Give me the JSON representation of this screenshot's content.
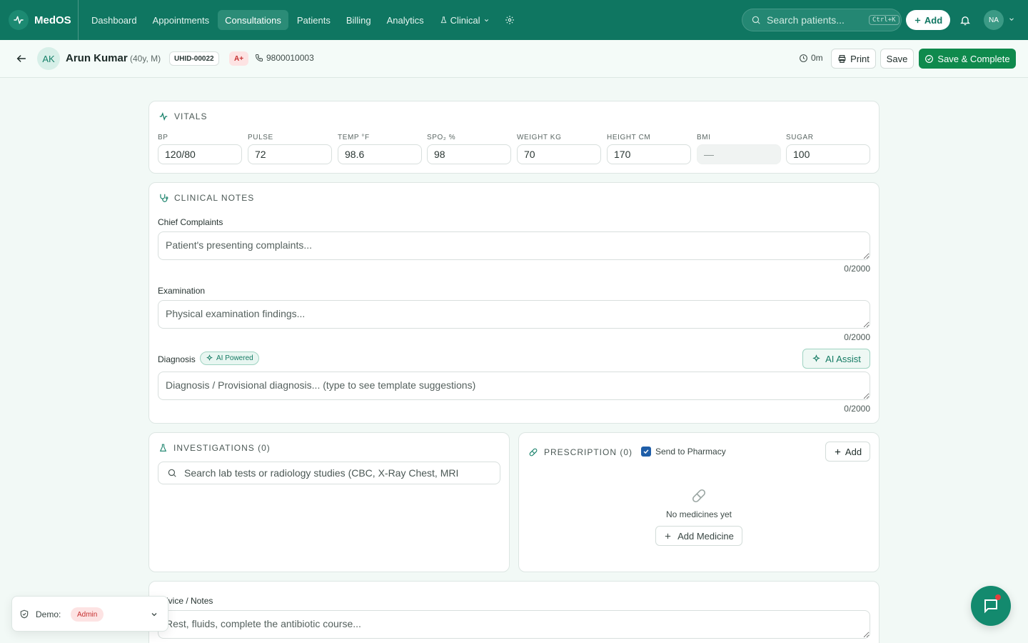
{
  "app": {
    "name": "MedOS"
  },
  "nav": {
    "items": [
      {
        "label": "Dashboard",
        "active": false
      },
      {
        "label": "Appointments",
        "active": false
      },
      {
        "label": "Consultations",
        "active": true
      },
      {
        "label": "Patients",
        "active": false
      },
      {
        "label": "Billing",
        "active": false
      },
      {
        "label": "Analytics",
        "active": false
      },
      {
        "label": "Clinical",
        "active": false
      }
    ],
    "search_placeholder": "Search patients...",
    "search_shortcut": "Ctrl+K",
    "add_label": "Add",
    "user_initials": "NA"
  },
  "patient": {
    "initials": "AK",
    "name": "Arun Kumar",
    "meta": "(40y, M)",
    "uhid": "UHID-00022",
    "blood_group": "A+",
    "phone": "9800010003",
    "timer": "0m",
    "print_label": "Print",
    "save_label": "Save",
    "complete_label": "Save & Complete"
  },
  "vitals": {
    "title": "Vitals",
    "fields": [
      {
        "label": "BP",
        "value": "120/80"
      },
      {
        "label": "Pulse",
        "value": "72"
      },
      {
        "label": "Temp °F",
        "value": "98.6"
      },
      {
        "label": "SpO₂ %",
        "value": "98"
      },
      {
        "label": "Weight kg",
        "value": "70"
      },
      {
        "label": "Height cm",
        "value": "170"
      },
      {
        "label": "BMI",
        "value": "—"
      },
      {
        "label": "Sugar",
        "value": "100"
      }
    ]
  },
  "notes": {
    "title": "Clinical Notes",
    "chief": {
      "label": "Chief Complaints",
      "placeholder": "Patient's presenting complaints...",
      "counter": "0/2000"
    },
    "exam": {
      "label": "Examination",
      "placeholder": "Physical examination findings...",
      "counter": "0/2000"
    },
    "diagnosis": {
      "label": "Diagnosis",
      "badge": "AI Powered",
      "assist": "AI Assist",
      "placeholder": "Diagnosis / Provisional diagnosis... (type to see template suggestions)",
      "counter": "0/2000"
    }
  },
  "investigations": {
    "title": "Investigations (0)",
    "search_placeholder": "Search lab tests or radiology studies (CBC, X-Ray Chest, MRI"
  },
  "prescription": {
    "title": "Prescription (0)",
    "pharmacy_label": "Send to Pharmacy",
    "add_label": "Add",
    "empty_text": "No medicines yet",
    "add_medicine_label": "Add Medicine"
  },
  "advice": {
    "label": "Advice / Notes",
    "placeholder": "Rest, fluids, complete the antibiotic course..."
  },
  "demo": {
    "label": "Demo:",
    "role": "Admin"
  }
}
